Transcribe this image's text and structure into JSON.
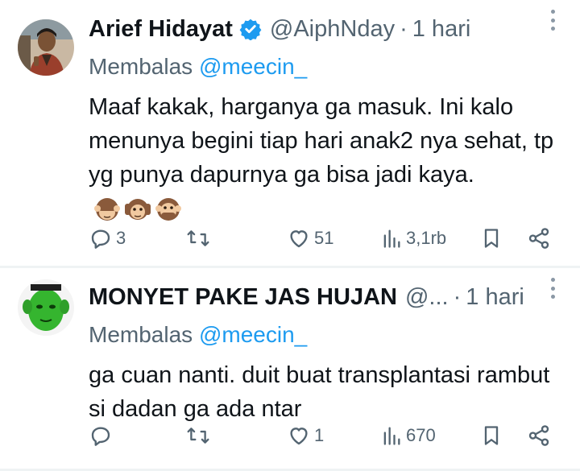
{
  "tweets": [
    {
      "author": {
        "name": "Arief Hidayat",
        "handle": "@AiphNday",
        "verified": true,
        "avatar": "man-portrait-avatar"
      },
      "time": "1 hari",
      "reply_prefix": "Membalas",
      "reply_to": "@meecin_",
      "text": "Maaf kakak, harganya ga masuk. Ini kalo menunya begini tiap hari anak2 nya sehat, tp yg punya dapurnya ga bisa jadi kaya.",
      "emojis": [
        "see-no-evil-monkey",
        "hear-no-evil-monkey",
        "speak-no-evil-monkey"
      ],
      "actions": {
        "replies": "3",
        "retweets": "",
        "likes": "51",
        "views": "3,1rb"
      }
    },
    {
      "author": {
        "name": "MONYET PAKE JAS HUJAN",
        "handle": "@...",
        "verified": false,
        "avatar": "green-face-avatar"
      },
      "time": "1 hari",
      "reply_prefix": "Membalas",
      "reply_to": "@meecin_",
      "text": "ga cuan nanti. duit buat transplantasi rambut si dadan ga ada ntar",
      "actions": {
        "replies": "",
        "retweets": "",
        "likes": "1",
        "views": "670"
      }
    }
  ],
  "colors": {
    "text": "#0f1419",
    "muted": "#536471",
    "link": "#1d9bf0",
    "verified": "#1d9bf0",
    "divider": "#eff3f4"
  }
}
